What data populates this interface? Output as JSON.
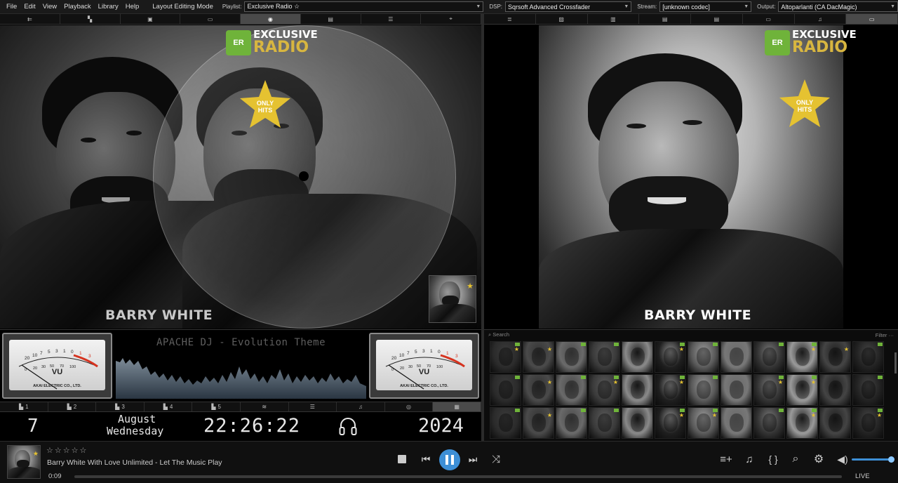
{
  "menu": {
    "items": [
      "File",
      "Edit",
      "View",
      "Playback",
      "Library",
      "Help",
      "Layout Editing Mode"
    ],
    "playlist_label": "Playlist:",
    "playlist_value": "Exclusive Radio ☆",
    "dsp_label": "DSP:",
    "dsp_value": "Sqrsoft Advanced Crossfader",
    "stream_label": "Stream:",
    "stream_value": "[unknown codec]",
    "output_label": "Output:",
    "output_value": "Altoparlanti (CA DacMagic)"
  },
  "left_tabs": [
    "back-arrow-icon",
    "book-icon",
    "radio-icon",
    "monitor-icon",
    "disc-icon",
    "screen-icon",
    "stack-icon",
    "target-icon"
  ],
  "right_tabs": [
    "list-icon",
    "image-icon",
    "folder-icon",
    "screen-icon",
    "screen-icon",
    "monitor-icon",
    "note-icon",
    "display-icon"
  ],
  "artwork": {
    "artist_name": "BARRY WHITE",
    "logo_badge": "ER",
    "logo_line1": "EXCLUSIVE",
    "logo_line2": "RADIO",
    "star_line1": "ONLY",
    "star_line2": "HITS"
  },
  "meters": {
    "theme_title": "APACHE DJ - Evolution Theme",
    "vu_label": "VU",
    "vu_brand": "AKAI ELECTRIC CO., LTD.",
    "scale": [
      "20",
      "10",
      "7",
      "5",
      "3",
      "1",
      "0",
      "1",
      "3"
    ],
    "scale_low": [
      "0",
      "20",
      "30",
      "50",
      "70",
      "100"
    ]
  },
  "low_tabs": [
    {
      "label": "1",
      "icon": "bars-icon"
    },
    {
      "label": "2",
      "icon": "bars-icon"
    },
    {
      "label": "3",
      "icon": "bars-icon"
    },
    {
      "label": "4",
      "icon": "bars-icon"
    },
    {
      "label": "5",
      "icon": "bars-icon"
    },
    {
      "label": "",
      "icon": "wave-icon"
    },
    {
      "label": "",
      "icon": "stack-icon"
    },
    {
      "label": "",
      "icon": "note-icon"
    },
    {
      "label": "",
      "icon": "globe-icon"
    },
    {
      "label": "",
      "icon": "calendar-icon"
    }
  ],
  "clock": {
    "day": "7",
    "month": "August",
    "weekday": "Wednesday",
    "time": "22:26:22",
    "year": "2024"
  },
  "library": {
    "search_placeholder": "Search",
    "filter_label": "Filter",
    "more": "···",
    "tiles": 36
  },
  "player": {
    "rating": "☆☆☆☆☆",
    "now_playing": "Barry White With Love Unlimited - Let The Music Play",
    "elapsed": "0:09",
    "live": "LIVE",
    "volume_fraction": 0.93,
    "accent": "#3d8fd6"
  }
}
